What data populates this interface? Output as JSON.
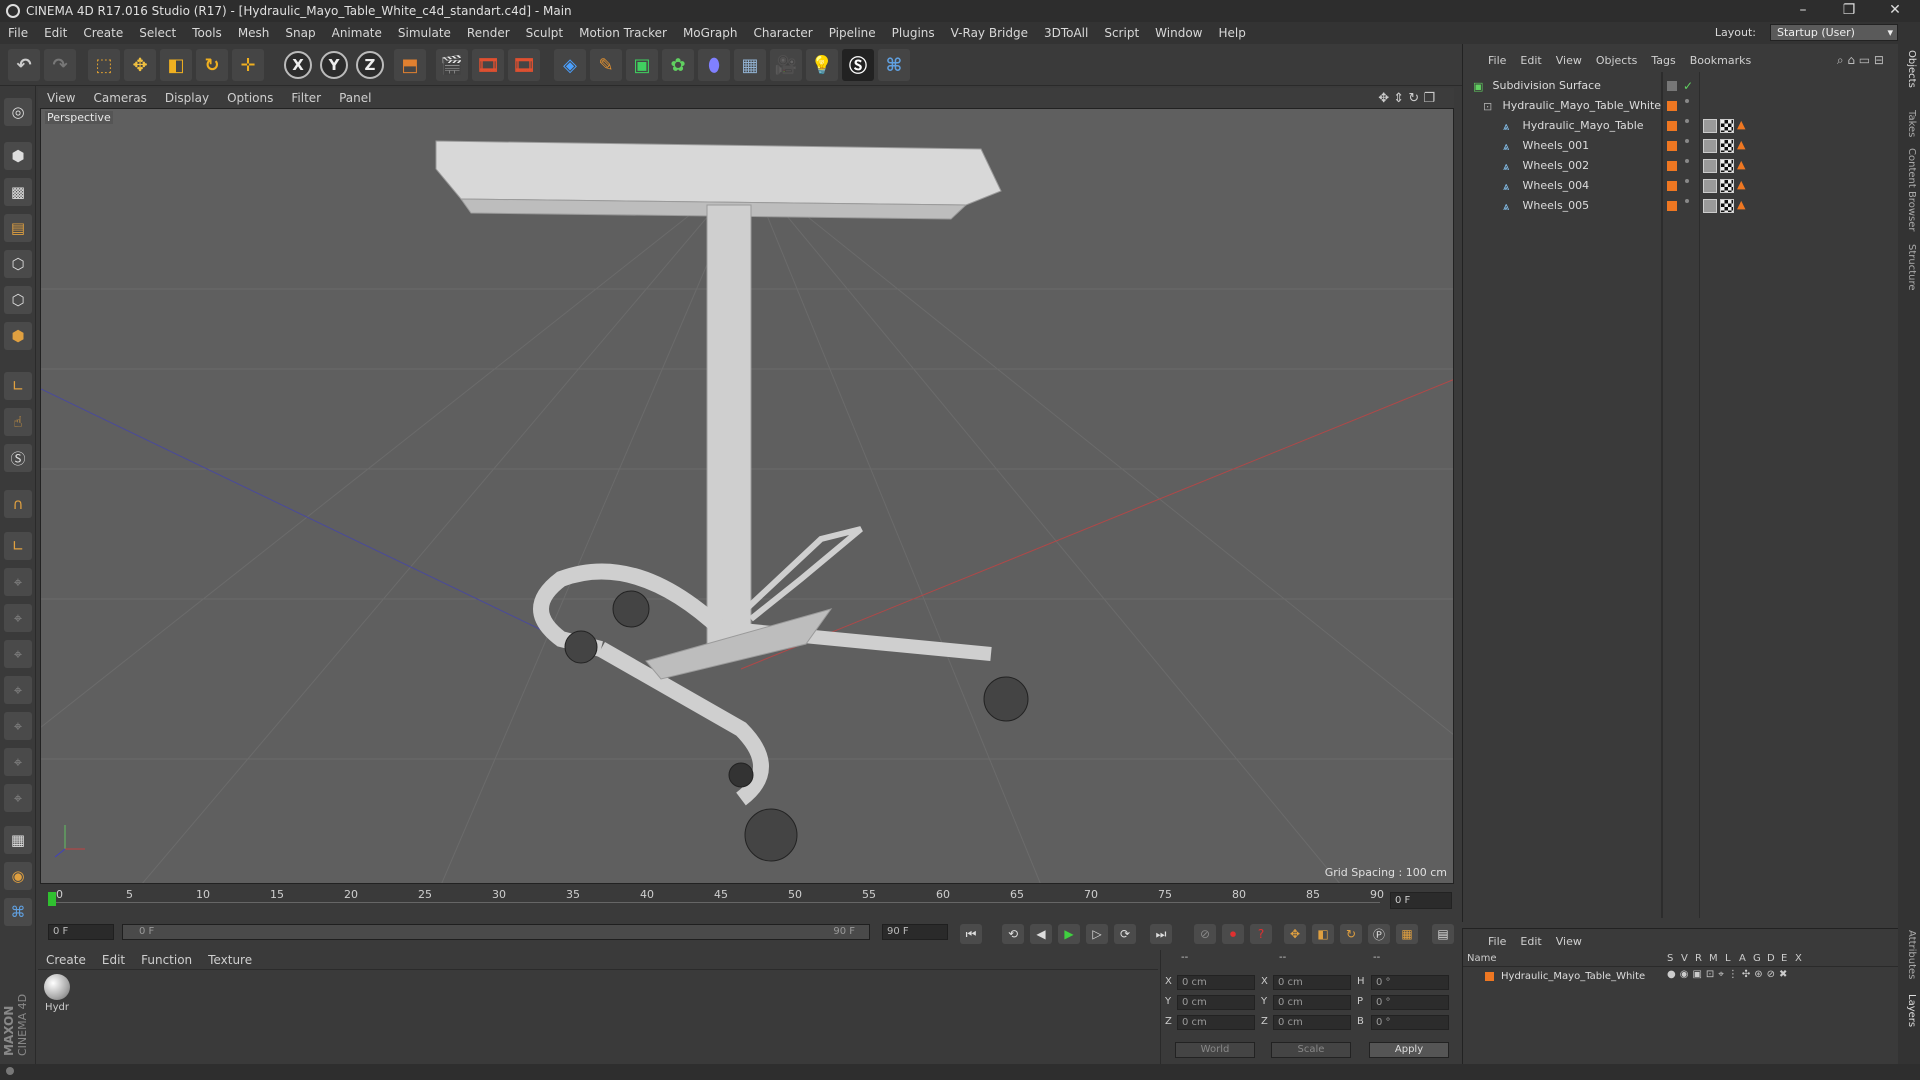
{
  "window": {
    "title": "CINEMA 4D R17.016 Studio (R17) - [Hydraulic_Mayo_Table_White_c4d_standart.c4d] - Main",
    "minimize": "–",
    "restore": "❐",
    "close": "✕"
  },
  "menubar": {
    "items": [
      "File",
      "Edit",
      "Create",
      "Select",
      "Tools",
      "Mesh",
      "Snap",
      "Animate",
      "Simulate",
      "Render",
      "Sculpt",
      "Motion Tracker",
      "MoGraph",
      "Character",
      "Pipeline",
      "Plugins",
      "V-Ray Bridge",
      "3DToAll",
      "Script",
      "Window",
      "Help"
    ],
    "layout_label": "Layout:",
    "layout_value": "Startup (User)"
  },
  "toolbar": {
    "axis_x": "X",
    "axis_y": "Y",
    "axis_z": "Z"
  },
  "viewport": {
    "menu": [
      "View",
      "Cameras",
      "Display",
      "Options",
      "Filter",
      "Panel"
    ],
    "label": "Perspective",
    "grid_spacing": "Grid Spacing : 100 cm",
    "colors": {
      "bg": "#5f5f5f",
      "grid": "#6c6c6c",
      "x_axis": "#c04040",
      "z_axis": "#4040a0",
      "model": "#d8d8d8"
    }
  },
  "timeline": {
    "ticks": [
      "0",
      "5",
      "10",
      "15",
      "20",
      "25",
      "30",
      "35",
      "40",
      "45",
      "50",
      "55",
      "60",
      "65",
      "70",
      "75",
      "80",
      "85",
      "90"
    ],
    "current_frame": "0 F"
  },
  "transport": {
    "start_field": "0 F",
    "range_start": "0 F",
    "range_end": "90 F",
    "end_field": "90 F"
  },
  "material_manager": {
    "menu": [
      "Create",
      "Edit",
      "Function",
      "Texture"
    ],
    "materials": [
      {
        "name": "Hydr"
      }
    ]
  },
  "coordinates": {
    "header": [
      "--",
      "--",
      "--"
    ],
    "rows": [
      {
        "a": "X",
        "pos": "0 cm",
        "b": "X",
        "size": "0 cm",
        "c": "H",
        "rot": "0 °"
      },
      {
        "a": "Y",
        "pos": "0 cm",
        "b": "Y",
        "size": "0 cm",
        "c": "P",
        "rot": "0 °"
      },
      {
        "a": "Z",
        "pos": "0 cm",
        "b": "Z",
        "size": "0 cm",
        "c": "B",
        "rot": "0 °"
      }
    ],
    "world": "World",
    "scale": "Scale",
    "apply": "Apply"
  },
  "object_manager": {
    "menu": [
      "File",
      "Edit",
      "View",
      "Objects",
      "Tags",
      "Bookmarks"
    ],
    "objects": [
      {
        "name": "Subdivision Surface"
      },
      {
        "name": "Hydraulic_Mayo_Table_White"
      },
      {
        "name": "Hydraulic_Mayo_Table"
      },
      {
        "name": "Wheels_001"
      },
      {
        "name": "Wheels_002"
      },
      {
        "name": "Wheels_004"
      },
      {
        "name": "Wheels_005"
      }
    ]
  },
  "layer_manager": {
    "menu": [
      "File",
      "Edit",
      "View"
    ],
    "columns": [
      "Name",
      "S",
      "V",
      "R",
      "M",
      "L",
      "A",
      "G",
      "D",
      "E",
      "X"
    ],
    "row_name": "Hydraulic_Mayo_Table_White"
  },
  "right_tabs": [
    "Objects",
    "Takes",
    "Content Browser",
    "Structure",
    "Attributes",
    "Layers"
  ],
  "branding": {
    "maxon": "MAXON",
    "c4d": "CINEMA 4D"
  }
}
